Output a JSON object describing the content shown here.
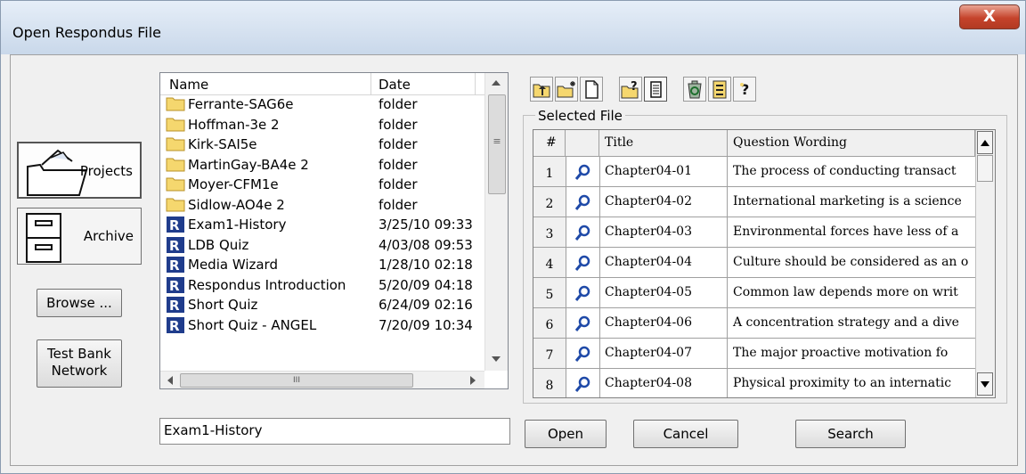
{
  "window": {
    "title": "Open Respondus File",
    "close_glyph": "X"
  },
  "nav": {
    "projects_label": "Projects",
    "archive_label": "Archive",
    "browse_label": "Browse ...",
    "test_bank_label_1": "Test Bank",
    "test_bank_label_2": "Network"
  },
  "file_list": {
    "col_name": "Name",
    "col_date": "Date",
    "rows": [
      {
        "icon": "folder-icon",
        "name": "Ferrante-SAG6e",
        "date": "folder"
      },
      {
        "icon": "folder-icon",
        "name": "Hoffman-3e 2",
        "date": "folder"
      },
      {
        "icon": "folder-icon",
        "name": "Kirk-SAI5e",
        "date": "folder"
      },
      {
        "icon": "folder-icon",
        "name": "MartinGay-BA4e 2",
        "date": "folder"
      },
      {
        "icon": "folder-icon",
        "name": "Moyer-CFM1e",
        "date": "folder"
      },
      {
        "icon": "folder-icon",
        "name": "Sidlow-AO4e 2",
        "date": "folder"
      },
      {
        "icon": "respondus-file-icon",
        "name": "Exam1-History",
        "date": "3/25/10  09:33"
      },
      {
        "icon": "respondus-file-icon",
        "name": "LDB Quiz",
        "date": "4/03/08  09:53"
      },
      {
        "icon": "respondus-file-icon",
        "name": "Media Wizard",
        "date": "1/28/10  02:18"
      },
      {
        "icon": "respondus-file-icon",
        "name": "Respondus Introduction",
        "date": "5/20/09  04:18"
      },
      {
        "icon": "respondus-file-icon",
        "name": "Short Quiz",
        "date": "6/24/09  02:16"
      },
      {
        "icon": "respondus-file-icon",
        "name": "Short Quiz - ANGEL",
        "date": "7/20/09  10:34"
      }
    ],
    "hscroll_grip": "III",
    "vscroll_grip": "≡"
  },
  "filename_input": {
    "value": "Exam1-History"
  },
  "toolbar": {
    "icons": [
      "parent-folder-icon",
      "new-folder-icon",
      "new-file-icon",
      "folder-help-icon",
      "details-view-icon",
      "recycle-icon",
      "properties-icon",
      "help-icon"
    ]
  },
  "selected_file": {
    "group_label": "Selected File",
    "columns": {
      "num": "#",
      "title": "Title",
      "wording": "Question Wording"
    },
    "rows": [
      {
        "num": "1",
        "title": "Chapter04-01",
        "wording": "The process of conducting transact"
      },
      {
        "num": "2",
        "title": "Chapter04-02",
        "wording": "International marketing is a science"
      },
      {
        "num": "3",
        "title": "Chapter04-03",
        "wording": "Environmental forces have less of a"
      },
      {
        "num": "4",
        "title": "Chapter04-04",
        "wording": "Culture should be considered as an o"
      },
      {
        "num": "5",
        "title": "Chapter04-05",
        "wording": "Common law depends more on writ"
      },
      {
        "num": "6",
        "title": "Chapter04-06",
        "wording": "A concentration strategy and a dive"
      },
      {
        "num": "7",
        "title": "Chapter04-07",
        "wording": "The major proactive motivation fo"
      },
      {
        "num": "8",
        "title": "Chapter04-08",
        "wording": "Physical proximity to an internatic"
      }
    ]
  },
  "buttons": {
    "open": "Open",
    "cancel": "Cancel",
    "search": "Search"
  }
}
